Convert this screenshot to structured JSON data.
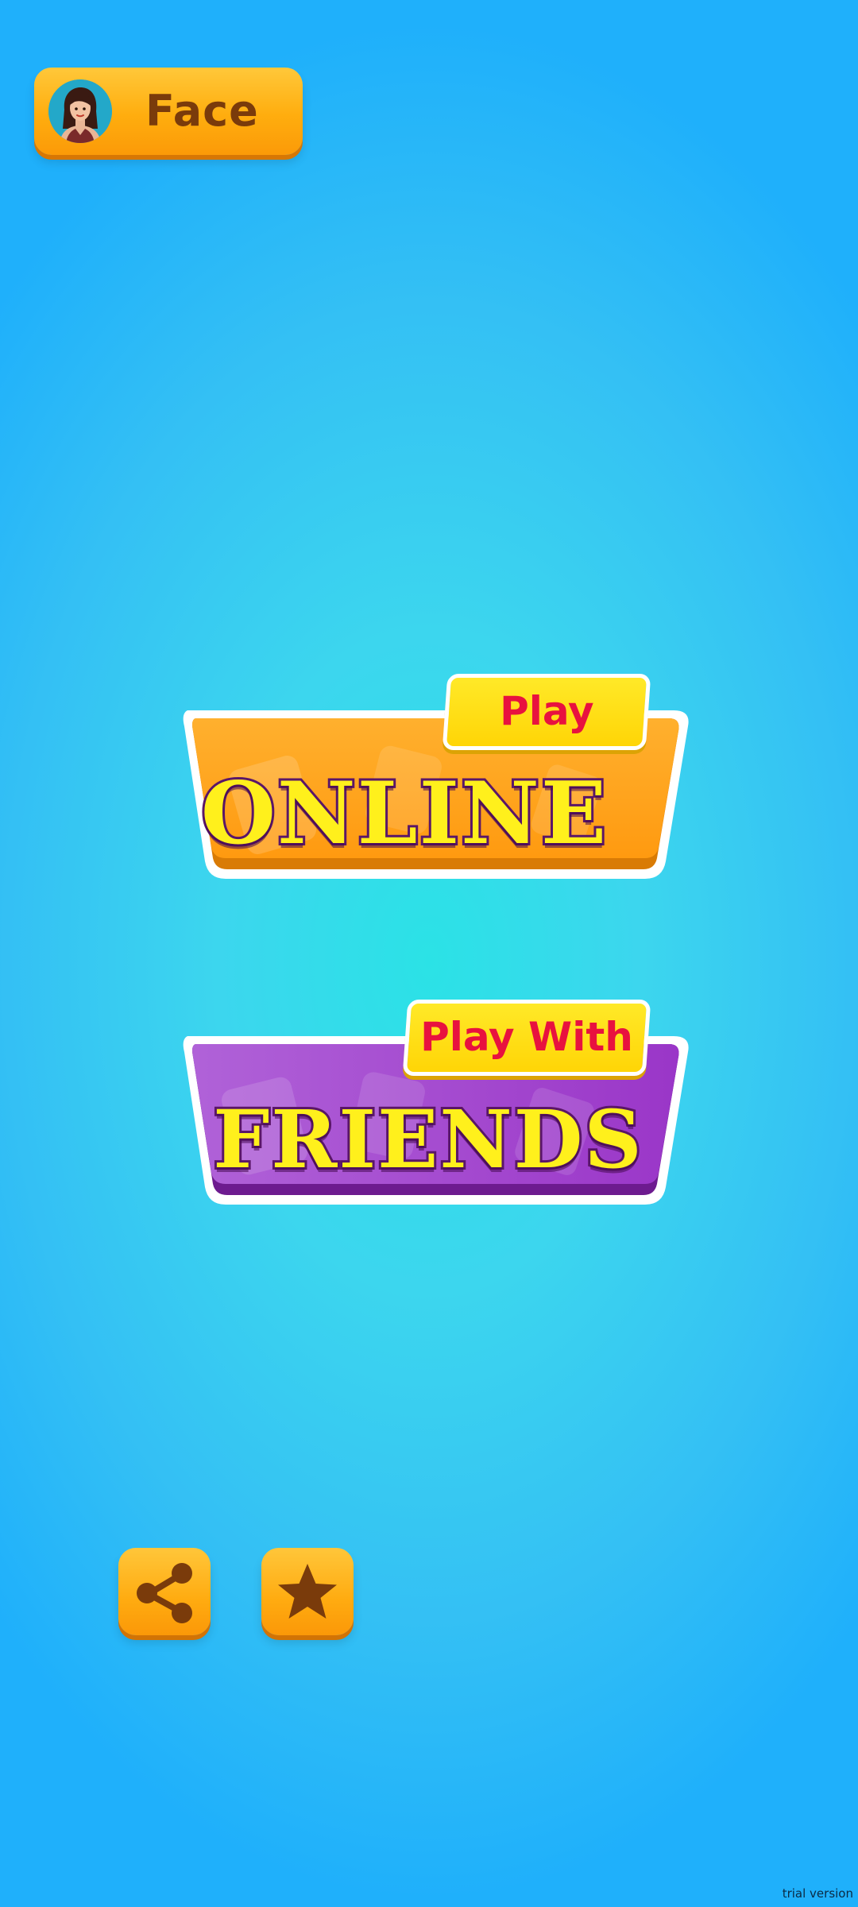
{
  "profile": {
    "name": "Face",
    "avatar_icon": "female-avatar"
  },
  "menu": {
    "online": {
      "tag": "Play",
      "label": "ONLINE",
      "color": "#ffa417"
    },
    "friends": {
      "tag": "Play With",
      "label": "FRIENDS",
      "color": "#a53fd0"
    }
  },
  "bottom_buttons": {
    "share_icon": "share-icon",
    "rate_icon": "star-icon"
  },
  "watermark": "trial version"
}
